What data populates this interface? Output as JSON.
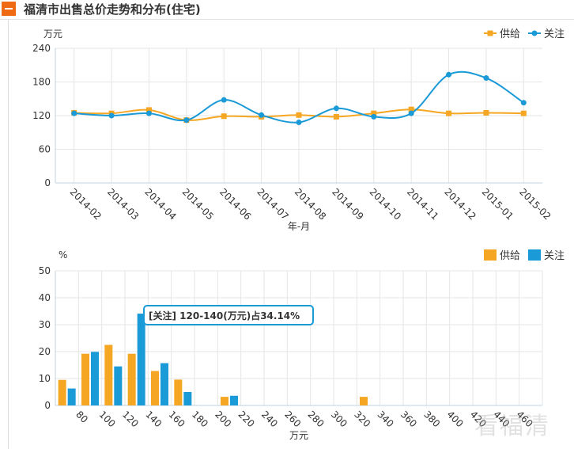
{
  "header": {
    "title": "福清市出售总价走势和分布(住宅)"
  },
  "watermark": "看福清",
  "colors": {
    "supply": "#f5a623",
    "attention": "#1a9ad6",
    "grid": "#e6e6e6",
    "axis": "#c0d0e0"
  },
  "chart_data": [
    {
      "type": "line",
      "unit_label": "万元",
      "xlabel": "年-月",
      "ylim": [
        0,
        240
      ],
      "yticks": [
        0,
        60,
        120,
        180,
        240
      ],
      "legend_position": "top-right",
      "categories": [
        "2014-02",
        "2014-03",
        "2014-04",
        "2014-05",
        "2014-06",
        "2014-07",
        "2014-08",
        "2014-09",
        "2014-10",
        "2014-11",
        "2014-12",
        "2015-01",
        "2015-02"
      ],
      "series": [
        {
          "name": "供给",
          "values": [
            125,
            124,
            130,
            112,
            119,
            118,
            121,
            118,
            124,
            131,
            124,
            125,
            124
          ]
        },
        {
          "name": "关注",
          "values": [
            124,
            120,
            124,
            112,
            148,
            121,
            108,
            133,
            118,
            124,
            193,
            187,
            143
          ]
        }
      ]
    },
    {
      "type": "bar",
      "unit_label": "%",
      "xlabel": "万元",
      "ylim": [
        0,
        50
      ],
      "yticks": [
        0,
        10,
        20,
        30,
        40,
        50
      ],
      "legend_position": "top-right",
      "categories": [
        "80",
        "100",
        "120",
        "140",
        "160",
        "180",
        "200",
        "220",
        "240",
        "260",
        "280",
        "300",
        "320",
        "340",
        "360",
        "380",
        "400",
        "420",
        "440",
        "460"
      ],
      "series": [
        {
          "name": "供给",
          "values": [
            9.5,
            19.2,
            22.5,
            19.2,
            12.8,
            9.6,
            0,
            3.2,
            0,
            0,
            0,
            0,
            0,
            3.2,
            0,
            0,
            0,
            0,
            0,
            0,
            0
          ]
        },
        {
          "name": "关注",
          "values": [
            6.3,
            19.9,
            14.5,
            34.1,
            15.7,
            5.0,
            0,
            3.6,
            0,
            0,
            0,
            0,
            0,
            0,
            0,
            0,
            0,
            0,
            0,
            0,
            0
          ]
        }
      ],
      "tooltip": "[关注] 120-140(万元)占34.14%"
    }
  ]
}
